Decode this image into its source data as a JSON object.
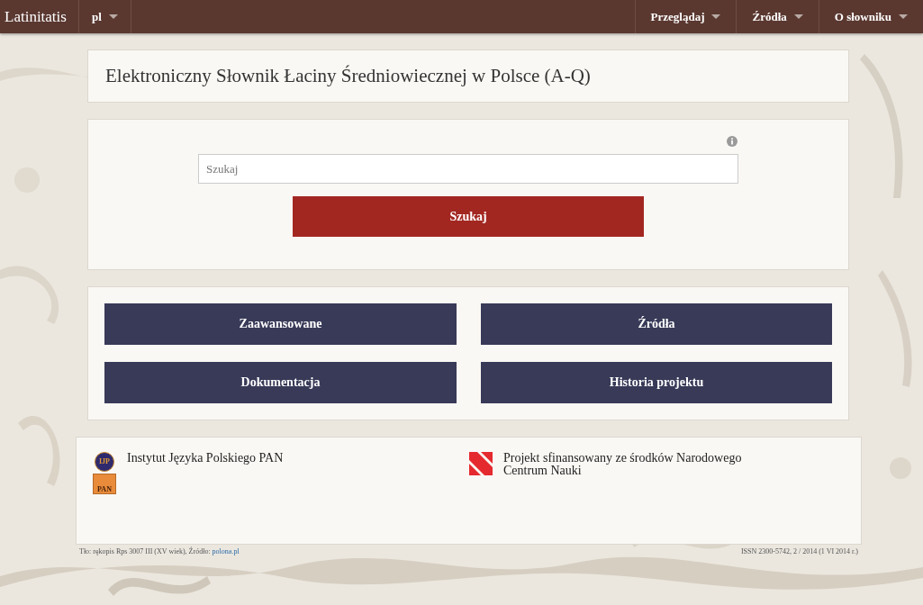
{
  "navbar": {
    "brand": "Latinitatis",
    "language": "pl",
    "menus": [
      {
        "label": "Przeglądaj"
      },
      {
        "label": "Źródła"
      },
      {
        "label": "O słowniku"
      }
    ]
  },
  "title": "Elektroniczny Słownik Łaciny Średniowiecznej w Polsce (A-Q)",
  "search": {
    "placeholder": "Szukaj",
    "button": "Szukaj"
  },
  "links": [
    "Zaawansowane",
    "Źródła",
    "Dokumentacja",
    "Historia projektu"
  ],
  "partners": [
    {
      "kind": "ijp",
      "logo_top": "IJP",
      "logo_bottom": "PAN",
      "text": "Instytut Języka Polskiego PAN"
    },
    {
      "kind": "ncn",
      "text": "Projekt sfinansowany ze środków Narodowego Centrum Nauki"
    }
  ],
  "credits": {
    "text": "Tło: rękopis Rps 3007 III (XV wiek), Źródło:",
    "link": "polona.pl",
    "issn": "ISSN 2300-5742, 2 / 2014 (1 VI 2014 r.)"
  }
}
